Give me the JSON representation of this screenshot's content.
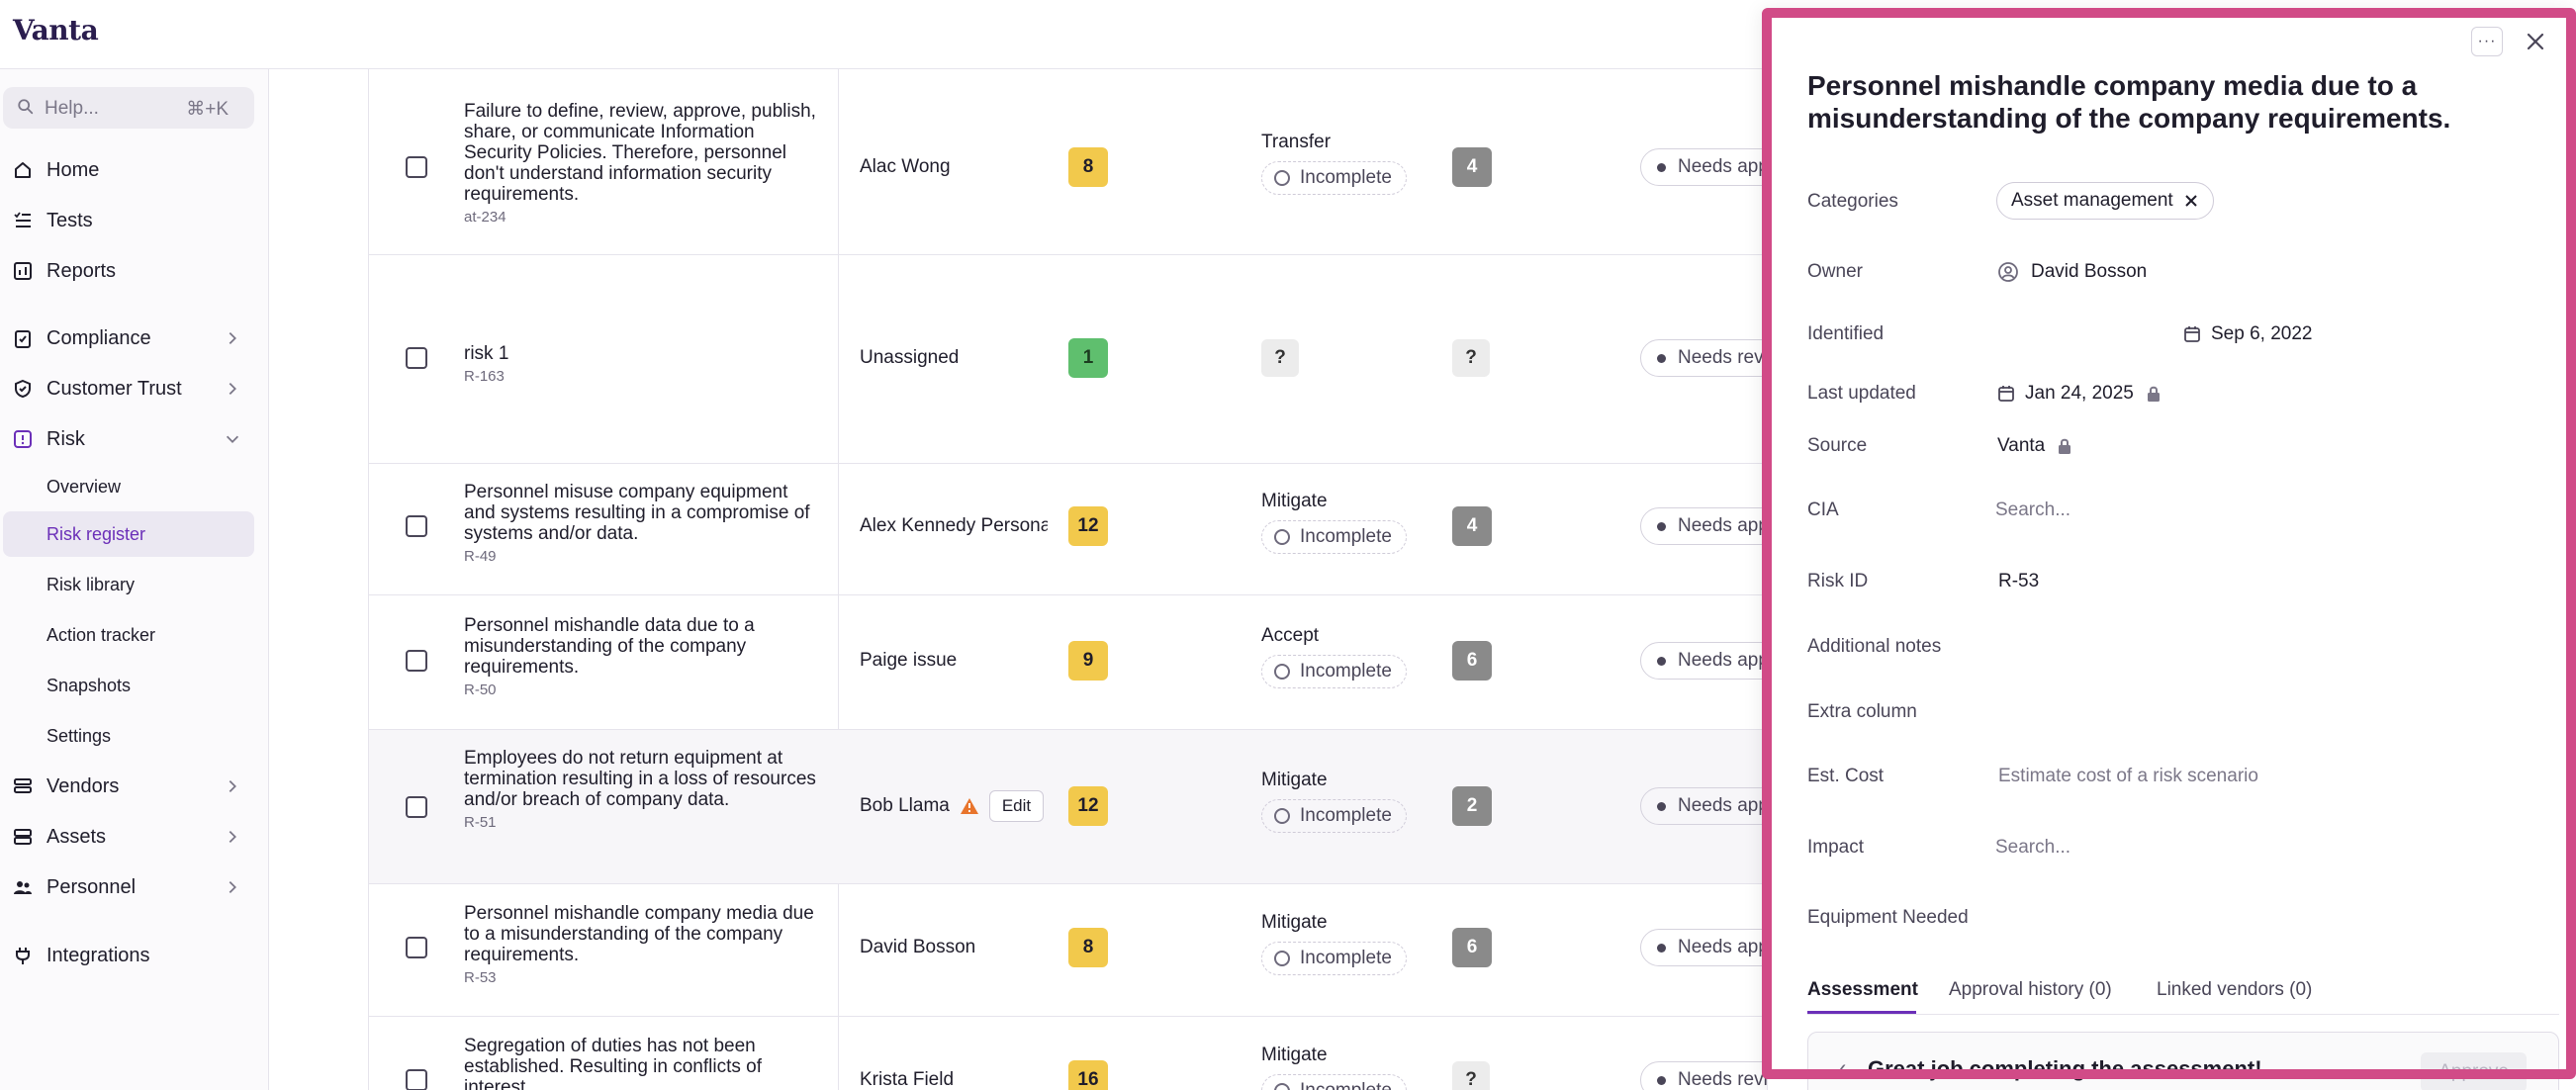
{
  "app": {
    "logo": "Vanta"
  },
  "search": {
    "placeholder": "Help...",
    "shortcut": "⌘+K"
  },
  "nav": {
    "home": "Home",
    "tests": "Tests",
    "reports": "Reports",
    "compliance": "Compliance",
    "customer_trust": "Customer Trust",
    "risk": "Risk",
    "risk_sub": [
      "Overview",
      "Risk register",
      "Risk library",
      "Action tracker",
      "Snapshots",
      "Settings"
    ],
    "vendors": "Vendors",
    "assets": "Assets",
    "personnel": "Personnel",
    "integrations": "Integrations"
  },
  "rows": [
    {
      "title": "Failure to define, review, approve, publish, share, or communicate Information Security Policies. Therefore, personnel don't understand information security requirements.",
      "id": "at-234",
      "owner": "Alac Wong",
      "score": "8",
      "treatment": "Transfer",
      "state": "Incomplete",
      "residual": "4",
      "status": "Needs approval"
    },
    {
      "title": "risk 1",
      "id": "R-163",
      "owner": "Unassigned",
      "score": "1",
      "treatment": "?",
      "state": "",
      "residual": "?",
      "status": "Needs review"
    },
    {
      "title": "Personnel misuse company equipment and systems resulting in a compromise of systems and/or data.",
      "id": "R-49",
      "owner": "Alex Kennedy Personal",
      "score": "12",
      "treatment": "Mitigate",
      "state": "Incomplete",
      "residual": "4",
      "status": "Needs approval"
    },
    {
      "title": "Personnel mishandle data due to a misunderstanding of the company requirements.",
      "id": "R-50",
      "owner": "Paige issue",
      "score": "9",
      "treatment": "Accept",
      "state": "Incomplete",
      "residual": "6",
      "status": "Needs approval"
    },
    {
      "title": "Employees do not return equipment at termination resulting in a loss of resources and/or breach of company data.",
      "id": "R-51",
      "owner": "Bob Llama",
      "edit": "Edit",
      "score": "12",
      "treatment": "Mitigate",
      "state": "Incomplete",
      "residual": "2",
      "status": "Needs approval"
    },
    {
      "title": "Personnel mishandle company media due to a misunderstanding of the company requirements.",
      "id": "R-53",
      "owner": "David Bosson",
      "score": "8",
      "treatment": "Mitigate",
      "state": "Incomplete",
      "residual": "6",
      "status": "Needs approval"
    },
    {
      "title": "Segregation of duties has not been established. Resulting in conflicts of interest.",
      "id": "",
      "owner": "Krista Field",
      "score": "16",
      "treatment": "Mitigate",
      "state": "Incomplete",
      "residual": "?",
      "status": "Needs review"
    }
  ],
  "drawer": {
    "more": "···",
    "title": "Personnel mishandle company media due to a misunderstanding of the company requirements.",
    "labels": {
      "categories": "Categories",
      "owner": "Owner",
      "identified": "Identified",
      "last_updated": "Last updated",
      "source": "Source",
      "cia": "CIA",
      "risk_id": "Risk ID",
      "additional_notes": "Additional notes",
      "extra_column": "Extra column",
      "est_cost": "Est. Cost",
      "impact": "Impact",
      "equipment_needed": "Equipment Needed"
    },
    "values": {
      "category_chip": "Asset management",
      "owner": "David Bosson",
      "identified": "Sep 6, 2022",
      "last_updated": "Jan 24, 2025",
      "source": "Vanta",
      "cia_placeholder": "Search...",
      "risk_id": "R-53",
      "est_cost_placeholder": "Estimate cost of a risk scenario",
      "impact_placeholder": "Search..."
    },
    "tabs": [
      "Assessment",
      "Approval history (0)",
      "Linked vendors (0)"
    ],
    "banner": {
      "text": "Great job completing the assessment!",
      "button": "Approve"
    }
  },
  "colors": {
    "accent": "#6b2fb8",
    "highlight_frame": "#d14b87",
    "score_yellow": "#f2c94c",
    "score_green": "#5fbf6e"
  }
}
